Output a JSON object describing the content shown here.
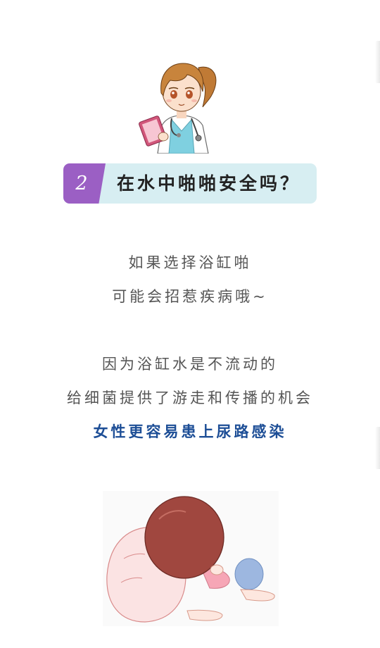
{
  "section": {
    "number": "2",
    "title": "在水中啪啪安全吗？"
  },
  "paragraphs": {
    "p1_line1": "如果选择浴缸啪",
    "p1_line2": "可能会招惹疾病哦~",
    "p2_line1": "因为浴缸水是不流动的",
    "p2_line2": "给细菌提供了游走和传播的机会",
    "p2_highlight": "女性更容易患上尿路感染"
  },
  "colors": {
    "number_badge": "#9b5fc4",
    "title_bar": "#d7eef2",
    "highlight_text": "#1d4e96",
    "body_text": "#555555"
  },
  "illustrations": {
    "top": "doctor-cartoon",
    "bottom": "girl-kneeling-in-pain-cartoon"
  }
}
